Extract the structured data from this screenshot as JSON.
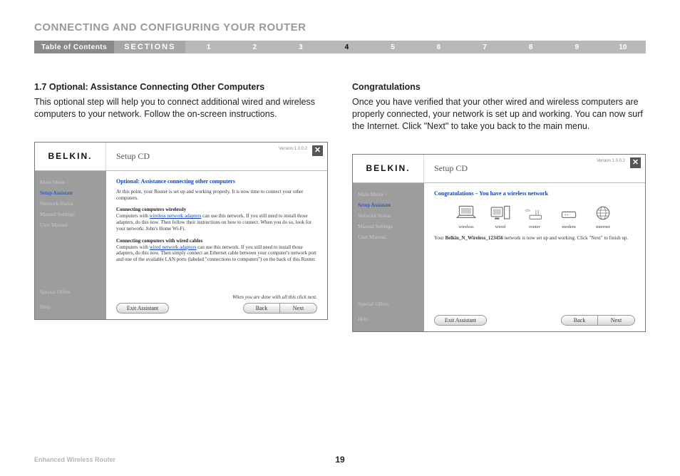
{
  "chapter_title": "CONNECTING AND CONFIGURING YOUR ROUTER",
  "nav": {
    "toc": "Table of Contents",
    "sections": "SECTIONS",
    "nums": [
      "1",
      "2",
      "3",
      "4",
      "5",
      "6",
      "7",
      "8",
      "9",
      "10"
    ],
    "active_index": 3
  },
  "left": {
    "heading": "1.7 Optional: Assistance Connecting Other Computers",
    "body": "This optional step will help you to connect additional wired and wireless computers to your network. Follow the on-screen instructions."
  },
  "right": {
    "heading": "Congratulations",
    "body": "Once you have verified that your other wired and wireless computers are properly connected, your network is set up and working. You can now surf the Internet. Click \"Next\" to take you back to the main menu."
  },
  "app_shared": {
    "logo": "BELKIN.",
    "title": "Setup CD",
    "version": "Version 1.0.0.2",
    "close": "✕",
    "sidebar": {
      "items": [
        "Main Menu  >",
        "Setup Assistant",
        "Network Status",
        "Manual Settings",
        "User Manual"
      ],
      "active_index": 1,
      "bottom": [
        "Special Offers",
        "Help"
      ]
    },
    "buttons": {
      "exit": "Exit Assistant",
      "back": "Back",
      "next": "Next"
    }
  },
  "app_left": {
    "title": "Optional: Assistance connecting other computers",
    "p1": "At this point, your Router is set up and working properly. It is now time to connect your other computers.",
    "sub1": "Connecting computers wirelessly",
    "p2_a": "Computers with ",
    "p2_link": "wireless network adapters",
    "p2_b": " can use this network. If you still need to install those adapters, do this now. Then follow their instructions on how to connect. When you do so, look for your network: John's Home Wi-Fi.",
    "sub2": "Connecting computers with wired cables",
    "p3_a": "Computers with ",
    "p3_link": "wired network adapters",
    "p3_b": " can use this network. If you still need to install those adapters, do this now. Then simply connect an Ethernet cable between your computer's network port and one of the available LAN ports (labeled \"connections to computers\") on the back of this Router.",
    "hint": "When you are done with all this click next."
  },
  "app_right": {
    "title": "Congratulations – You have a wireless network",
    "devices": [
      "wireless",
      "wired",
      "router",
      "modem",
      "internet"
    ],
    "p1_a": "Your ",
    "p1_bold": "Belkin_N_Wireless_123456",
    "p1_b": " network is now set up and working. Click \"Next\" to finish up."
  },
  "footer": {
    "product": "Enhanced Wireless Router",
    "page": "19"
  }
}
